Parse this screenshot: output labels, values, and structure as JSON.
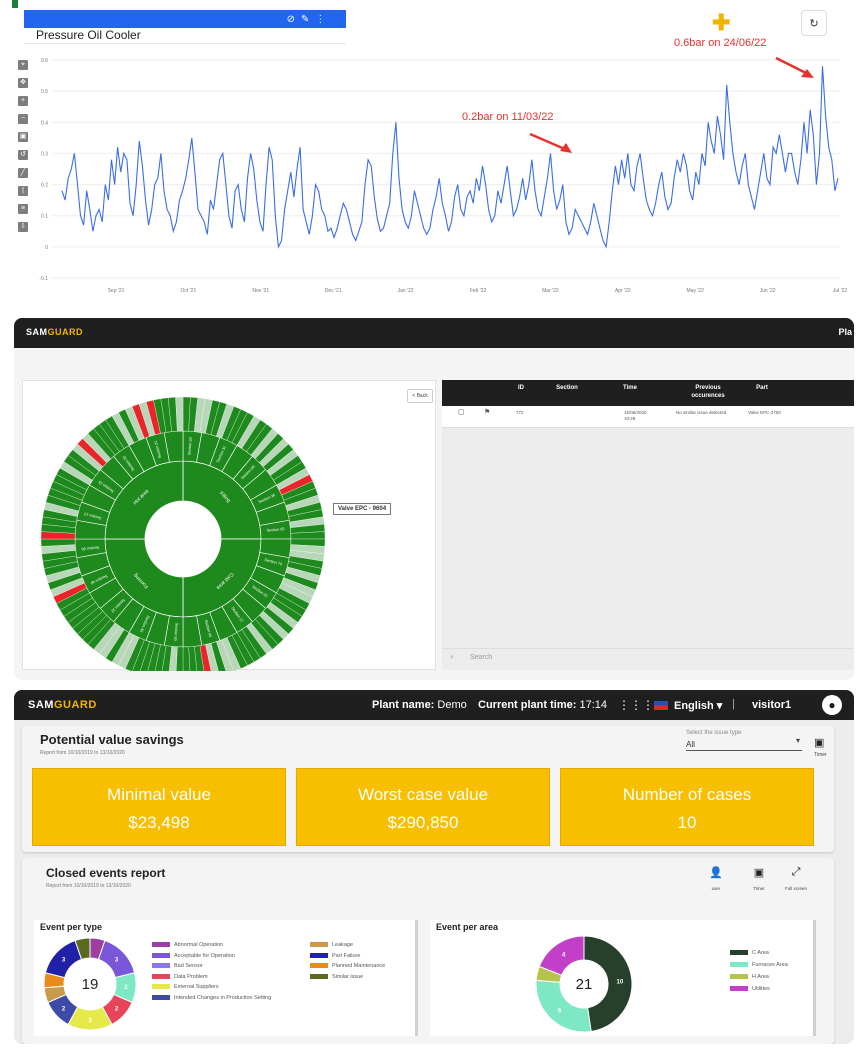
{
  "chart_panel": {
    "title": "Pressure Oil Cooler",
    "refresh_icon": "refresh-icon",
    "add_icon": "plus-icon",
    "annotations": [
      {
        "text": "0.2bar on 11/03/22",
        "color": "#e8302c"
      },
      {
        "text": "0.6bar on 24/06/22",
        "color": "#e8302c"
      }
    ]
  },
  "chart_data": {
    "type": "line",
    "title": "Pressure Oil Cooler",
    "xlabel": "",
    "ylabel": "",
    "x_ticks": [
      "Sep '21",
      "Oct '21",
      "Nov '21",
      "Dec '21",
      "Jan '22",
      "Feb '22",
      "Mar '22",
      "Apr '22",
      "May '22",
      "Jun '22",
      "Jul '22"
    ],
    "y_ticks": [
      "0.6",
      "0.5",
      "0.4",
      "0.3",
      "0.2",
      "0.1",
      "0",
      "-0.1"
    ],
    "ylim": [
      -0.1,
      0.6
    ],
    "grid": true,
    "series_color": "#3b6de8",
    "series": [
      {
        "name": "",
        "values": [
          0.18,
          0.15,
          0.22,
          0.25,
          0.3,
          0.2,
          0.1,
          0.07,
          0.18,
          0.12,
          0.05,
          0.1,
          0.12,
          0.08,
          0.2,
          0.15,
          0.28,
          0.2,
          0.32,
          0.24,
          0.3,
          0.28,
          0.14,
          0.1,
          0.2,
          0.34,
          0.26,
          0.15,
          0.07,
          0.12,
          0.2,
          0.22,
          0.3,
          0.18,
          0.12,
          0.1,
          0.05,
          0.08,
          0.15,
          0.18,
          0.22,
          0.28,
          0.35,
          0.24,
          0.12,
          0.1,
          0.08,
          0.04,
          0.15,
          0.12,
          0.2,
          0.28,
          0.3,
          0.2,
          0.1,
          0.06,
          0.18,
          0.2,
          0.12,
          0.08,
          0.22,
          0.3,
          0.25,
          0.15,
          0.08,
          0.05,
          0.2,
          0.32,
          0.28,
          0.1,
          0.0,
          0.02,
          0.12,
          0.18,
          0.24,
          0.16,
          0.25,
          0.32,
          0.12,
          0.08,
          0.04,
          0.1,
          0.2,
          0.18,
          0.12,
          0.1,
          0.05,
          0.06,
          0.03,
          0.06,
          0.1,
          0.14,
          0.12,
          0.08,
          0.04,
          0.02,
          0.05,
          0.08,
          0.2,
          0.28,
          0.26,
          0.16,
          0.09,
          0.05,
          0.06,
          0.1,
          0.14,
          0.3,
          0.4,
          0.22,
          0.12,
          0.08,
          0.06,
          0.1,
          0.18,
          0.14,
          0.1,
          0.06,
          0.04,
          0.06,
          0.12,
          0.16,
          0.22,
          0.14,
          0.1,
          0.05,
          0.08,
          0.16,
          0.2,
          0.12,
          0.1,
          0.16,
          0.18,
          0.14,
          0.22,
          0.18,
          0.26,
          0.2,
          0.12,
          0.08,
          0.1,
          0.18,
          0.14,
          0.2,
          0.26,
          0.18,
          0.1,
          0.12,
          0.16,
          0.22,
          0.15,
          0.2,
          0.28,
          0.18,
          0.12,
          0.1,
          0.16,
          0.22,
          0.3,
          0.18,
          0.12,
          0.15,
          0.2,
          0.08,
          0.04,
          0.06,
          0.12,
          0.1,
          0.08,
          0.06,
          0.04,
          0.08,
          0.14,
          0.1,
          0.06,
          0.02,
          0.0,
          0.08,
          0.18,
          0.26,
          0.2,
          0.28,
          0.22,
          0.3,
          0.2,
          0.18,
          0.26,
          0.3,
          0.22,
          0.15,
          0.12,
          0.1,
          0.14,
          0.2,
          0.24,
          0.16,
          0.12,
          0.14,
          0.22,
          0.28,
          0.24,
          0.3,
          0.26,
          0.18,
          0.15,
          0.24,
          0.2,
          0.3,
          0.26,
          0.4,
          0.34,
          0.3,
          0.42,
          0.36,
          0.28,
          0.52,
          0.4,
          0.3,
          0.24,
          0.2,
          0.26,
          0.3,
          0.2,
          0.16,
          0.12,
          0.18,
          0.24,
          0.3,
          0.22,
          0.2,
          0.32,
          0.3,
          0.36,
          0.3,
          0.24,
          0.3,
          0.3,
          0.24,
          0.2,
          0.28,
          0.4,
          0.3,
          0.44,
          0.36,
          0.2,
          0.3,
          0.58,
          0.42,
          0.32,
          0.28,
          0.18,
          0.22
        ]
      }
    ]
  },
  "sunburst_panel": {
    "logo": {
      "part1": "SAM",
      "part2": "GUARD"
    },
    "top_right": "Pla",
    "back_label": "< Back",
    "tooltip": "Valve EPC - 9604",
    "table_headers": [
      "ID",
      "Section",
      "Time",
      "Previous occurences",
      "Part"
    ],
    "row": {
      "id": "772",
      "time": "15/06/2020 10:28",
      "previous": "No similar issue detected",
      "part": "Valve EPC-2750"
    },
    "search_placeholder": "Search",
    "sunburst_colors": {
      "base": "#1e8a1e",
      "alert": "#e8262a",
      "light": "#b8d6b8"
    },
    "sunburst_inner": [
      "Filling",
      "Cold area",
      "Forming",
      "Hot area"
    ],
    "sunburst_mid": [
      "Section 33",
      "Section 31",
      "Section 89",
      "Section 36",
      "Section 65",
      "Section 74",
      "Section 32",
      "Section 17",
      "Section 44",
      "Section 50",
      "Section 45",
      "Section 22",
      "Section 48",
      "Section 86",
      "Section 12",
      "Section 15"
    ]
  },
  "dashboard": {
    "logo": {
      "part1": "SAM",
      "part2": "GUARD"
    },
    "plant_label": "Plant name:",
    "plant_value": "Demo",
    "time_label": "Current plant time:",
    "time_value": "17:14",
    "language": "English",
    "user": "visitor1",
    "savings": {
      "title": "Potential value savings",
      "subtitle": "Report from 10/10/2019 to 13/10/2020",
      "select_label": "Select the issue type",
      "select_value": "All",
      "timer_label": "Timer",
      "kpis": [
        {
          "title": "Minimal value",
          "value": "$23,498"
        },
        {
          "title": "Worst case value",
          "value": "$290,850"
        },
        {
          "title": "Number of cases",
          "value": "10"
        }
      ]
    },
    "closed": {
      "title": "Closed events report",
      "subtitle": "Report from 10/10/2019 to 13/10/2020",
      "user_label": "user",
      "timer_label": "Timer",
      "fullscreen_label": "Full screen"
    },
    "event_type": {
      "title": "Event per type",
      "total": "19",
      "legend": [
        {
          "label": "Abnormal Operation",
          "color": "#9c3fa0"
        },
        {
          "label": "Acceptable for Operation",
          "color": "#7a56d8"
        },
        {
          "label": "Bad Sensor",
          "color": "#8e74f0"
        },
        {
          "label": "Data Problem",
          "color": "#e8445a"
        },
        {
          "label": "External Suppliers",
          "color": "#e5e94a"
        },
        {
          "label": "Intended Changes in Production Setting",
          "color": "#3e4aa8"
        },
        {
          "label": "Leakage",
          "color": "#c89a4a"
        },
        {
          "label": "Part Failure",
          "color": "#2020a8"
        },
        {
          "label": "Planned Maintenance",
          "color": "#e88a1c"
        },
        {
          "label": "Similar issue",
          "color": "#5a6a1e"
        }
      ],
      "slices": [
        {
          "value": 1,
          "color": "#9c3fa0",
          "label": ""
        },
        {
          "value": 3,
          "color": "#7a56d8",
          "label": "3"
        },
        {
          "value": 2,
          "color": "#7ee8c4",
          "label": "2"
        },
        {
          "value": 2,
          "color": "#e8445a",
          "label": "2"
        },
        {
          "value": 3,
          "color": "#e5e94a",
          "label": "3"
        },
        {
          "value": 2,
          "color": "#3e4aa8",
          "label": "2"
        },
        {
          "value": 1,
          "color": "#c89a4a",
          "label": ""
        },
        {
          "value": 1,
          "color": "#e88a1c",
          "label": ""
        },
        {
          "value": 3,
          "color": "#2020a8",
          "label": "3"
        },
        {
          "value": 1,
          "color": "#5a6a1e",
          "label": ""
        }
      ]
    },
    "event_area": {
      "title": "Event per area",
      "total": "21",
      "legend": [
        {
          "label": "C Area",
          "color": "#26402c"
        },
        {
          "label": "Furnaces Area",
          "color": "#7ee8c4"
        },
        {
          "label": "H Area",
          "color": "#b6c24a"
        },
        {
          "label": "Utilities",
          "color": "#c43fc8"
        }
      ],
      "slices": [
        {
          "value": 10,
          "color": "#26402c",
          "label": "10"
        },
        {
          "value": 6,
          "color": "#7ee8c4",
          "label": "6"
        },
        {
          "value": 1,
          "color": "#b6c24a",
          "label": ""
        },
        {
          "value": 4,
          "color": "#c43fc8",
          "label": "4"
        }
      ]
    }
  }
}
